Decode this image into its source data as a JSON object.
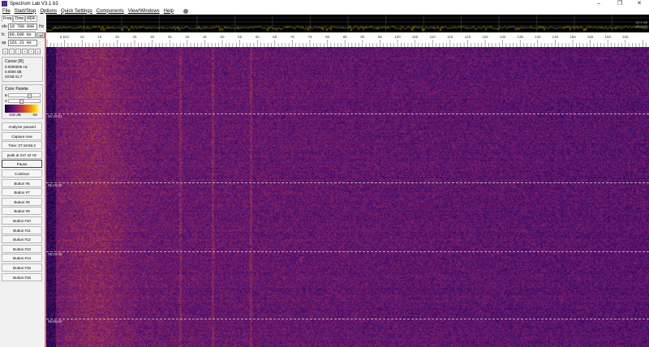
{
  "window": {
    "title": "Spectrum Lab V3.1 b3",
    "minimize": "–",
    "restore": "❐",
    "close": "✕"
  },
  "menu": [
    "File",
    "Start/Stop",
    "Options",
    "Quick Settings",
    "Components",
    "View/Windows",
    "Help"
  ],
  "tabs": [
    "Freq",
    "Time",
    "RDF"
  ],
  "freq": {
    "vfo_label": "vfo",
    "vfo": "10 700 000",
    "vfo_unit": "Hz",
    "fc_label": "fc",
    "fc": "80.606 Hz",
    "fc_btn": "opt",
    "sp_label": "sp",
    "sp": "161.21 Hz"
  },
  "arrows": [
    "«",
    "‹",
    "›",
    "»",
    "^",
    "v"
  ],
  "cursor": {
    "title": "Cursor [R]",
    "freq": "0.0000000 Hz",
    "level": "0.0000 dB",
    "time": "03:58:41.7"
  },
  "palette": {
    "title": "Color Palette",
    "b_label": "B",
    "c_label": "C",
    "min": "-100 dB",
    "max": "-50",
    "brightness": 0.65,
    "contrast": 0.35
  },
  "buttons": [
    "Analyzer paused",
    "Capture now",
    "Time:  07:18:58.3",
    "peak at 247.42 Hz",
    "Pause",
    "Continue",
    "Button #6",
    "Button #7",
    "Button #8",
    "Button #9",
    "Button #10",
    "Button #11",
    "Button #12",
    "Button #13",
    "Button #14",
    "Button #15",
    "Button #16"
  ],
  "spectrum": {
    "db_labels": [
      "-60.0 dB",
      "-80.0 dB"
    ],
    "color": "#d8d000"
  },
  "ruler": {
    "unit": "kHz",
    "ticks": [
      5,
      10,
      15,
      20,
      25,
      30,
      35,
      40,
      45,
      50,
      55,
      60,
      65,
      70,
      75,
      80,
      85,
      90,
      95,
      100,
      105,
      110,
      115,
      120,
      125,
      130,
      135,
      140,
      145,
      150,
      155,
      160,
      165
    ]
  },
  "waterfall": {
    "timestamps": [
      "05:20:01",
      "05:15:00",
      "05:10:00",
      "05:05:00"
    ]
  }
}
